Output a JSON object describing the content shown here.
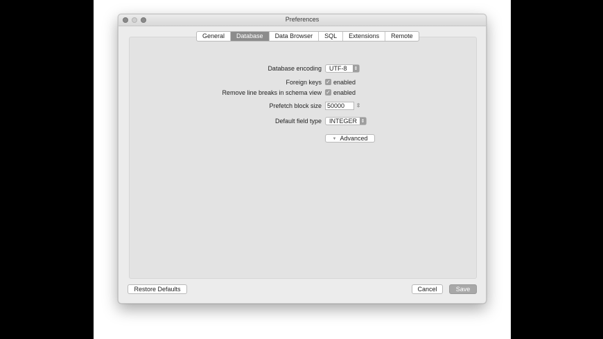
{
  "window": {
    "title": "Preferences"
  },
  "tabs": [
    {
      "label": "General",
      "active": false
    },
    {
      "label": "Database",
      "active": true
    },
    {
      "label": "Data Browser",
      "active": false
    },
    {
      "label": "SQL",
      "active": false
    },
    {
      "label": "Extensions",
      "active": false
    },
    {
      "label": "Remote",
      "active": false
    }
  ],
  "database": {
    "encoding_label": "Database encoding",
    "encoding_value": "UTF-8",
    "foreign_keys_label": "Foreign keys",
    "foreign_keys_option": "enabled",
    "foreign_keys_checked": true,
    "line_breaks_label": "Remove line breaks in schema view",
    "line_breaks_option": "enabled",
    "line_breaks_checked": true,
    "prefetch_label": "Prefetch block size",
    "prefetch_value": "50000",
    "field_type_label": "Default field type",
    "field_type_value": "INTEGER",
    "advanced_label": "Advanced"
  },
  "footer": {
    "restore_label": "Restore Defaults",
    "cancel_label": "Cancel",
    "save_label": "Save"
  },
  "icons": {
    "checkmark": "checkmark-icon",
    "stepper": "up-down-stepper-icon",
    "disclosure": "disclosure-triangle-icon"
  }
}
